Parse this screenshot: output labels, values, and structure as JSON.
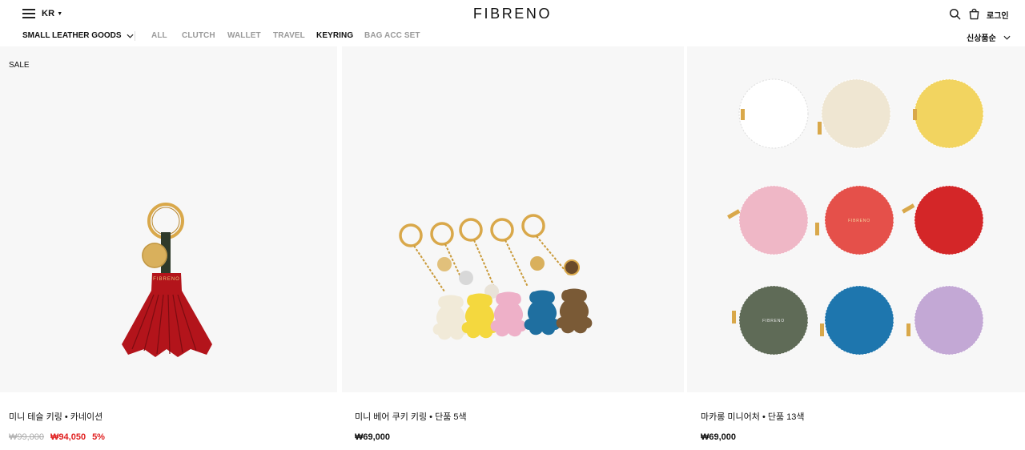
{
  "header": {
    "region": "KR",
    "logo": "FIBRENO",
    "login": "로그인"
  },
  "subnav": {
    "category": "SMALL LEATHER GOODS",
    "links": [
      "ALL",
      "CLUTCH",
      "WALLET",
      "TRAVEL",
      "KEYRING",
      "BAG ACC SET"
    ],
    "active": "KEYRING",
    "sort": "신상품순"
  },
  "products": [
    {
      "badge": "SALE",
      "name": "미니 테슬 키링 • 카네이션",
      "old_price": "₩99,000",
      "price": "₩94,050",
      "discount": "5%",
      "brand_mark": "FIBRENO"
    },
    {
      "name": "미니 베어 쿠키 키링 • 단품 5색",
      "price": "₩69,000"
    },
    {
      "name": "마카롱 미니어처 • 단품 13색",
      "price": "₩69,000",
      "brand_mark": "FIBRENO"
    }
  ],
  "colors": {
    "sale_red": "#e02020",
    "tassel_red": "#b3141b",
    "gold": "#d9a84a",
    "image_bg": "#f7f7f7"
  },
  "icons": [
    "menu-icon",
    "caret-down-icon",
    "search-icon",
    "cart-icon",
    "chevron-down-icon"
  ]
}
